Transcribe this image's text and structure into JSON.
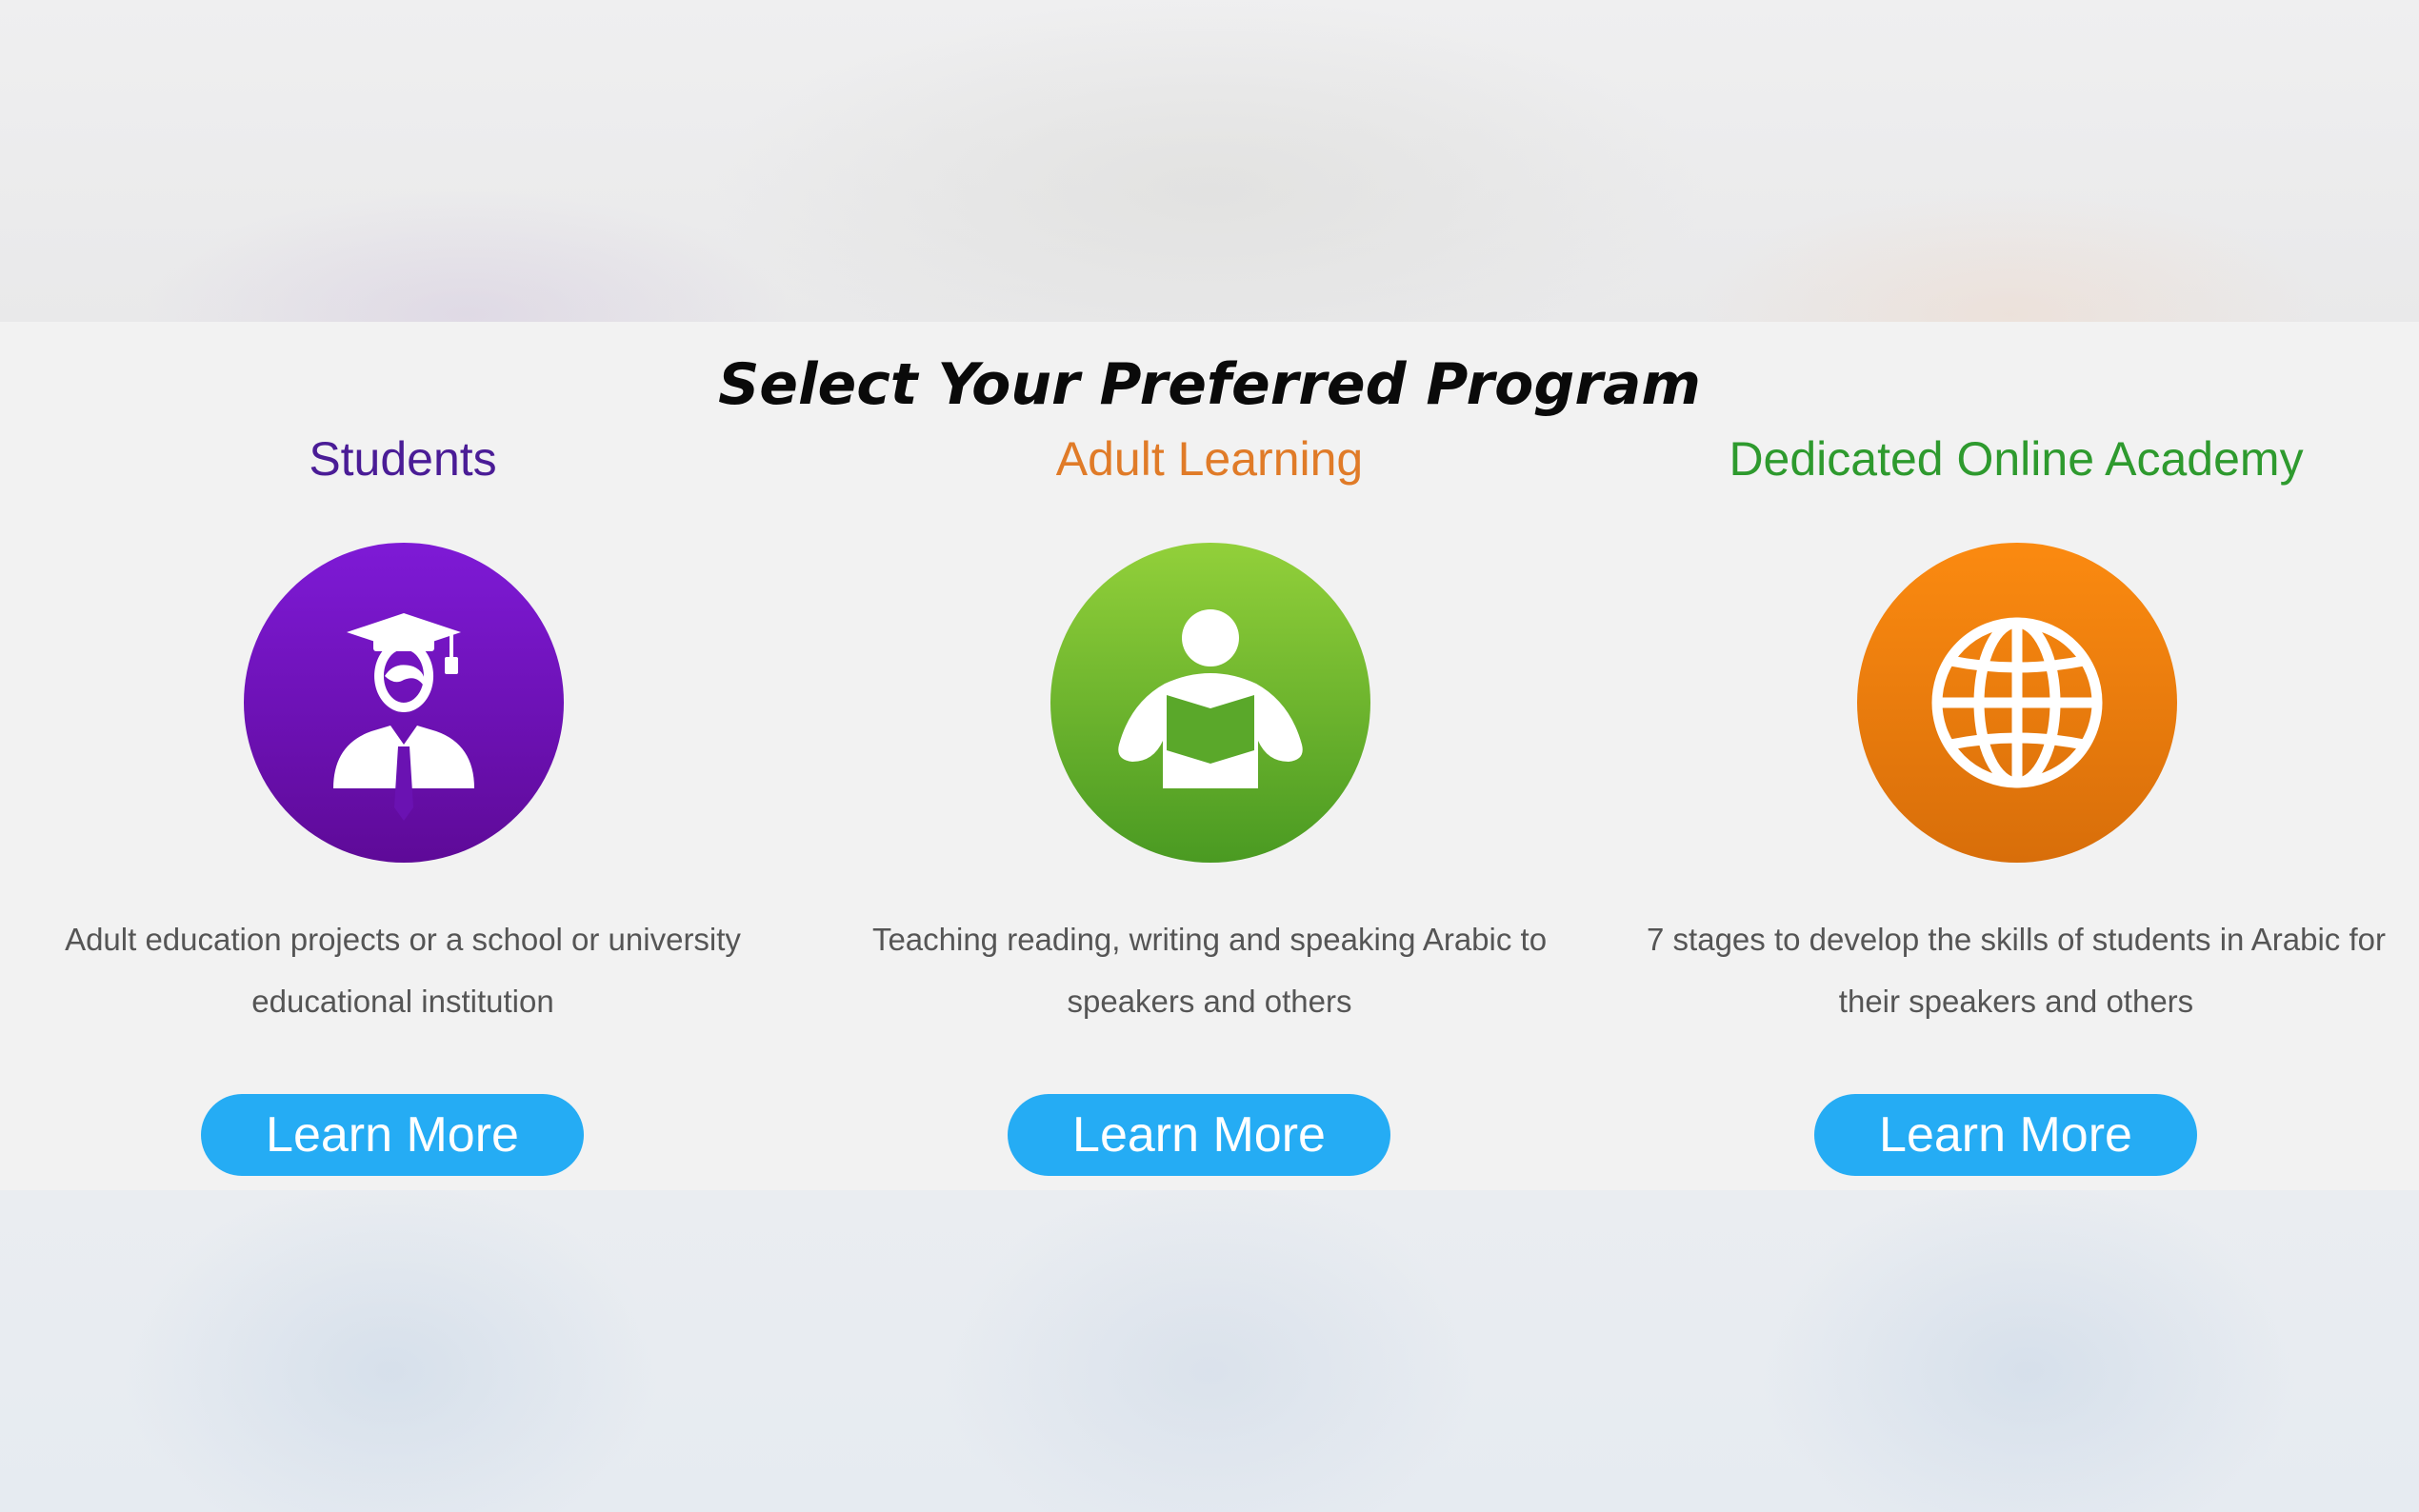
{
  "page": {
    "heading": "Select Your Preferred Program"
  },
  "programs": [
    {
      "title": "Students",
      "title_color": "#4a1c96",
      "icon": "graduate-icon",
      "circle_colors": [
        "#7e1ad6",
        "#5e0a98"
      ],
      "description": "Adult education projects or a school or university educational institution",
      "button_label": "Learn More"
    },
    {
      "title": "Adult Learning",
      "title_color": "#e07b28",
      "icon": "reading-person-icon",
      "circle_colors": [
        "#92d03a",
        "#4a9a22"
      ],
      "description": "Teaching reading, writing and speaking Arabic to speakers and others",
      "button_label": "Learn More"
    },
    {
      "title": "Dedicated Online Academy",
      "title_color": "#2e9a2e",
      "icon": "globe-icon",
      "circle_colors": [
        "#fb8a10",
        "#d86e0a"
      ],
      "description": "7 stages to develop the skills of students in Arabic for their speakers and others",
      "button_label": "Learn More"
    }
  ],
  "colors": {
    "button": "#25acf4",
    "section_background": "#f2f2f2",
    "description_text": "#555555"
  }
}
